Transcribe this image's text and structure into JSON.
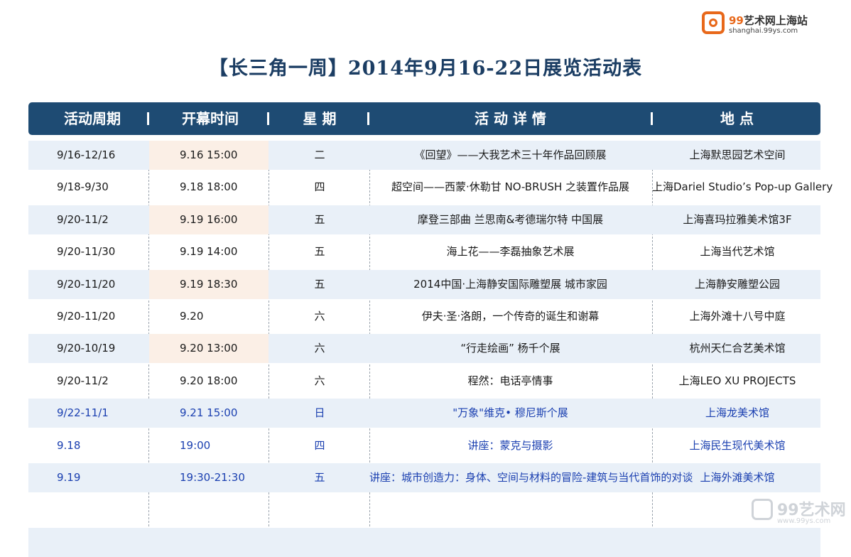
{
  "logo": {
    "name_num": "99",
    "name_text": "艺术网上海站",
    "sub": "shanghai.99ys.com"
  },
  "title": "【长三角一周】2014年9月16-22日展览活动表",
  "header": [
    "活动周期",
    "开幕时间",
    "星 期",
    "活 动 详 情",
    "地 点"
  ],
  "rows": [
    {
      "period": "9/16-12/16",
      "time": "9.16    15:00",
      "weekday": "二",
      "detail": "《回望》——大我艺术三十年作品回顾展",
      "venue": "上海默思园艺术空间"
    },
    {
      "period": "9/18-9/30",
      "time": "9.18    18:00",
      "weekday": "四",
      "detail": "超空间——西蒙·休勒甘 NO-BRUSH 之装置作品展",
      "venue": "上海Dariel Studio’s Pop-up Gallery"
    },
    {
      "period": "9/20-11/2",
      "time": "9.19    16:00",
      "weekday": "五",
      "detail": "摩登三部曲 兰思南&考德瑞尔特 中国展",
      "venue": "上海喜玛拉雅美术馆3F"
    },
    {
      "period": "9/20-11/30",
      "time": "9.19    14:00",
      "weekday": "五",
      "detail": "海上花——李磊抽象艺术展",
      "venue": "上海当代艺术馆"
    },
    {
      "period": "9/20-11/20",
      "time": "9.19    18:30",
      "weekday": "五",
      "detail": "2014中国·上海静安国际雕塑展 城市家园",
      "venue": "上海静安雕塑公园"
    },
    {
      "period": "9/20-11/20",
      "time": "9.20",
      "weekday": "六",
      "detail": "伊夫·圣·洛朗，一个传奇的诞生和谢幕",
      "venue": "上海外滩十八号中庭"
    },
    {
      "period": "9/20-10/19",
      "time": "9.20    13:00",
      "weekday": "六",
      "detail": "“行走绘画”  杨千个展",
      "venue": "杭州天仁合艺美术馆"
    },
    {
      "period": "9/20-11/2",
      "time": "9.20    18:00",
      "weekday": "六",
      "detail": "程然：电话亭情事",
      "venue": "上海LEO XU PROJECTS"
    },
    {
      "period": "9/22-11/1",
      "time": "9.21    15:00",
      "weekday": "日",
      "detail": "\"万象\"维克• 穆尼斯个展",
      "venue": "上海龙美术馆"
    },
    {
      "period": "9.18",
      "time": "19:00",
      "weekday": "四",
      "detail": "讲座：蒙克与摄影",
      "venue": "上海民生现代美术馆"
    },
    {
      "period": "9.19",
      "time": "19:30-21:30",
      "weekday": "五",
      "detail": "讲座：城市创造力：身体、空间与材料的冒险-建筑与当代首饰的对谈",
      "venue": "上海外滩美术馆"
    }
  ],
  "watermark": {
    "name": "99艺术网",
    "url": "www.99ys.com"
  },
  "colors": {
    "header_bg": "#1e4b73",
    "title": "#1b3d63",
    "row_shade": "#e9f0f8",
    "col_shade": "#fbefe6",
    "blue_text": "#1a3fb0",
    "logo_orange": "#e8681a"
  }
}
